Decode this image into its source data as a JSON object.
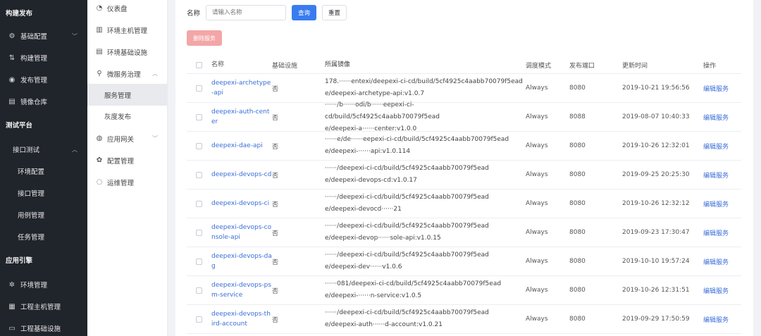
{
  "sidebar_dark": {
    "items": [
      {
        "label": "构建发布",
        "type": "group",
        "icon": ""
      },
      {
        "label": "基础配置",
        "type": "item",
        "icon": "sliders-icon",
        "glyph": "⚙",
        "chevron": "﹀"
      },
      {
        "label": "构建管理",
        "type": "item",
        "icon": "build-icon",
        "glyph": "⇅"
      },
      {
        "label": "发布管理",
        "type": "item",
        "icon": "release-icon",
        "glyph": "◉"
      },
      {
        "label": "镜像仓库",
        "type": "item",
        "icon": "registry-icon",
        "glyph": "▤"
      },
      {
        "label": "测试平台",
        "type": "group",
        "icon": ""
      },
      {
        "label": "接口测试",
        "type": "sub",
        "icon": "",
        "chevron": "︿"
      },
      {
        "label": "环境配置",
        "type": "sub2",
        "icon": ""
      },
      {
        "label": "接口管理",
        "type": "sub2",
        "icon": ""
      },
      {
        "label": "用例管理",
        "type": "sub2",
        "icon": ""
      },
      {
        "label": "任务管理",
        "type": "sub2",
        "icon": ""
      },
      {
        "label": "应用引擎",
        "type": "group",
        "icon": ""
      },
      {
        "label": "环境管理",
        "type": "item",
        "icon": "environment-icon",
        "glyph": "✲"
      },
      {
        "label": "工程主机管理",
        "type": "item",
        "icon": "host-icon",
        "glyph": "▦"
      },
      {
        "label": "工程基础设施",
        "type": "item",
        "icon": "infrastructure-icon",
        "glyph": "▭"
      }
    ]
  },
  "sidebar_light": {
    "items": [
      {
        "label": "仪表盘",
        "type": "item",
        "icon": "dashboard-icon",
        "glyph": "◔"
      },
      {
        "label": "环境主机管理",
        "type": "item",
        "icon": "host-icon",
        "glyph": "▥"
      },
      {
        "label": "环境基础设施",
        "type": "item",
        "icon": "infrastructure-icon",
        "glyph": "▤"
      },
      {
        "label": "微服务治理",
        "type": "item",
        "icon": "microservice-icon",
        "glyph": "⚲",
        "chevron": "︿"
      },
      {
        "label": "服务管理",
        "type": "sub",
        "active": true
      },
      {
        "label": "灰度发布",
        "type": "sub"
      },
      {
        "label": "应用网关",
        "type": "item",
        "icon": "gateway-icon",
        "glyph": "◍",
        "chevron": "﹀"
      },
      {
        "label": "配置管理",
        "type": "item",
        "icon": "config-icon",
        "glyph": "✿"
      },
      {
        "label": "运维管理",
        "type": "item",
        "icon": "ops-icon",
        "glyph": "◌"
      }
    ]
  },
  "search": {
    "label": "名称",
    "placeholder": "请输入名称",
    "query_button": "查询",
    "reset_button": "重置"
  },
  "delete_button": "删除服务",
  "table": {
    "headers": [
      "名称",
      "基础设施",
      "所属镜像",
      "调度模式",
      "发布端口",
      "更新时间",
      "操作"
    ],
    "rows": [
      {
        "name": "deepexi-archetype-api",
        "base": "否",
        "image_line1": "178.······entexi/deepexi-ci-cd/build/5cf4925c4aabb70079f5ead",
        "image_line2": "e/deepexi-archetype-api:v1.0.7",
        "mode": "Always",
        "port": "8080",
        "time": "2019-10-21 19:56:56",
        "op": "编辑服务"
      },
      {
        "name": "deepexi-auth-center",
        "base": "否",
        "image_line1": "······/b······odi/b······eepexi-ci-cd/build/5cf4925c4aabb70079f5ead",
        "image_line2": "e/deepexi-a······center:v1.0.0",
        "mode": "Always",
        "port": "8088",
        "time": "2019-08-07 10:40:33",
        "op": "编辑服务"
      },
      {
        "name": "deepexi-dae-api",
        "base": "否",
        "image_line1": "······e/de······eepexi-ci-cd/build/5cf4925c4aabb70079f5ead",
        "image_line2": "e/deepexi-······api:v1.0.114",
        "mode": "Always",
        "port": "8080",
        "time": "2019-10-26 12:32:01",
        "op": "编辑服务"
      },
      {
        "name": "deepexi-devops-cd",
        "base": "否",
        "image_line1": "······/deepexi-ci-cd/build/5cf4925c4aabb70079f5ead",
        "image_line2": "e/deepexi-devops-cd:v1.0.17",
        "mode": "Always",
        "port": "8080",
        "time": "2019-09-25 20:25:30",
        "op": "编辑服务"
      },
      {
        "name": "deepexi-devops-ci",
        "base": "否",
        "image_line1": "······/deepexi-ci-cd/build/5cf4925c4aabb70079f5ead",
        "image_line2": "e/deepexi-devocd······21",
        "mode": "Always",
        "port": "8080",
        "time": "2019-10-26 12:32:12",
        "op": "编辑服务"
      },
      {
        "name": "deepexi-devops-console-api",
        "base": "否",
        "image_line1": "······/deepexi-ci-cd/build/5cf4925c4aabb70079f5ead",
        "image_line2": "e/deepexi-devop······sole-api:v1.0.15",
        "mode": "Always",
        "port": "8080",
        "time": "2019-09-23 17:30:47",
        "op": "编辑服务"
      },
      {
        "name": "deepexi-devops-dag",
        "base": "否",
        "image_line1": "······/deepexi-ci-cd/build/5cf4925c4aabb70079f5ead",
        "image_line2": "e/deepexi-dev······v1.0.6",
        "mode": "Always",
        "port": "8080",
        "time": "2019-10-10 19:57:24",
        "op": "编辑服务"
      },
      {
        "name": "deepexi-devops-psm-service",
        "base": "否",
        "image_line1": "······081/deepexi-ci-cd/build/5cf4925c4aabb70079f5ead",
        "image_line2": "e/deepexi-······n-service:v1.0.5",
        "mode": "Always",
        "port": "8080",
        "time": "2019-10-26 12:31:51",
        "op": "编辑服务"
      },
      {
        "name": "deepexi-devops-third-account",
        "base": "否",
        "image_line1": "······/deepexi-ci-cd/build/5cf4925c4aabb70079f5ead",
        "image_line2": "e/deepexi-auth······d-account:v1.0.21",
        "mode": "Always",
        "port": "8080",
        "time": "2019-09-29 17:50:59",
        "op": "编辑服务"
      }
    ]
  },
  "colors": {
    "sidebar_dark": "#20242b",
    "primary": "#3a7cf0",
    "danger_disabled": "#f3a6a6",
    "link": "#3a6fd8"
  }
}
